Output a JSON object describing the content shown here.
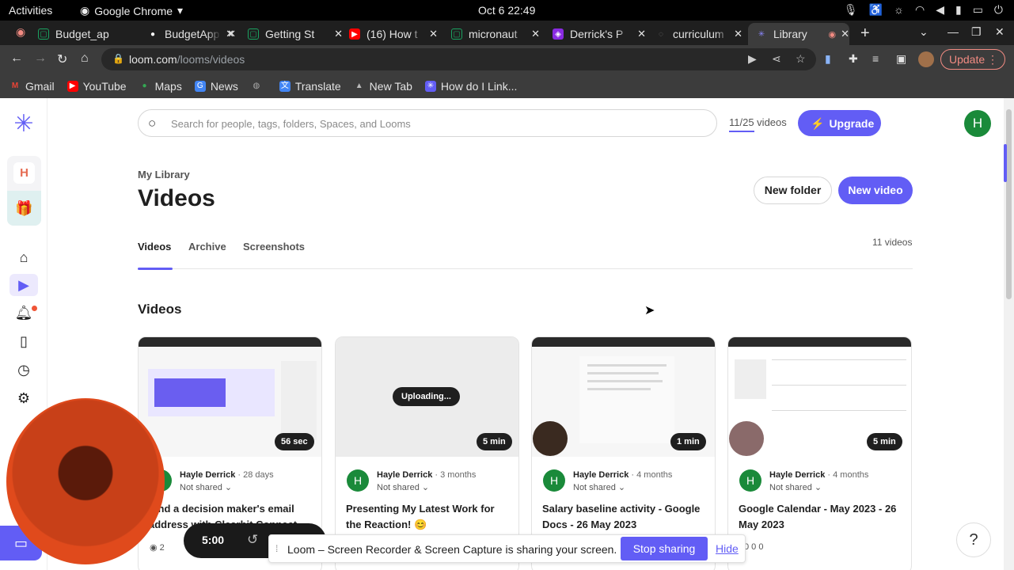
{
  "gnome": {
    "activities": "Activities",
    "app": "Google Chrome",
    "clock": "Oct 6  22:49"
  },
  "tabs": [
    {
      "title": "Budget_ap",
      "color": "#1aa260",
      "glyph": "▢"
    },
    {
      "title": "BudgetApp",
      "color": "#ffffff",
      "glyph": "●"
    },
    {
      "title": "Getting St",
      "color": "#1aa260",
      "glyph": "▢"
    },
    {
      "title": "(16) How t",
      "color": "#ff0000",
      "glyph": "▶"
    },
    {
      "title": "micronaut",
      "color": "#1aa260",
      "glyph": "▢"
    },
    {
      "title": "Derrick's P",
      "color": "#8a2be2",
      "glyph": "◈"
    },
    {
      "title": "curriculum",
      "color": "#555555",
      "glyph": "◌"
    },
    {
      "title": "Library",
      "color": "#625df5",
      "glyph": "✳"
    }
  ],
  "toolbar": {
    "url_host": "loom.com",
    "url_path": "/looms/videos",
    "update": "Update"
  },
  "bookmarks": [
    {
      "label": "Gmail",
      "color": "#ea4335",
      "glyph": "M"
    },
    {
      "label": "YouTube",
      "color": "#ff0000",
      "glyph": "▶"
    },
    {
      "label": "Maps",
      "color": "#34a853",
      "glyph": "●"
    },
    {
      "label": "News",
      "color": "#4285f4",
      "glyph": "G"
    },
    {
      "label": "",
      "color": "#777777",
      "glyph": "◍"
    },
    {
      "label": "Translate",
      "color": "#4285f4",
      "glyph": "文"
    },
    {
      "label": "New Tab",
      "color": "#888888",
      "glyph": "▲"
    },
    {
      "label": "How do I Link...",
      "color": "#625df5",
      "glyph": "✳"
    }
  ],
  "rail": {
    "workspace_initial": "H"
  },
  "header": {
    "search_placeholder": "Search for people, tags, folders, Spaces, and Looms",
    "video_count": "11/25 videos",
    "upgrade": "Upgrade",
    "user_initial": "H"
  },
  "page": {
    "breadcrumb": "My Library",
    "title": "Videos",
    "new_folder": "New folder",
    "new_video": "New video",
    "total": "11 videos",
    "section": "Videos",
    "tabs": [
      "Videos",
      "Archive",
      "Screenshots"
    ]
  },
  "cards": [
    {
      "duration": "56 sec",
      "author": "Hayle Derrick",
      "age": "28 days",
      "shared": "Not shared ⌄",
      "title": "Find a decision maker's email address with Clearbit Connect",
      "stats": "2"
    },
    {
      "duration": "5 min",
      "status": "Uploading...",
      "author": "Hayle Derrick",
      "age": "3 months",
      "shared": "Not shared ⌄",
      "title": "Presenting My Latest Work for the Reaction! 😊",
      "stats": ""
    },
    {
      "duration": "1 min",
      "author": "Hayle Derrick",
      "age": "4 months",
      "shared": "Not shared ⌄",
      "title": "Salary baseline activity - Google Docs - 26 May 2023",
      "stats": ""
    },
    {
      "duration": "5 min",
      "author": "Hayle Derrick",
      "age": "4 months",
      "shared": "Not shared ⌄",
      "title": "Google Calendar - May 2023 - 26 May 2023",
      "stats": "0   0   0"
    }
  ],
  "recorder": {
    "time": "5:00"
  },
  "share_bar": {
    "message": "Loom – Screen Recorder & Screen Capture is sharing your screen.",
    "stop": "Stop sharing",
    "hide": "Hide"
  },
  "help": "?"
}
